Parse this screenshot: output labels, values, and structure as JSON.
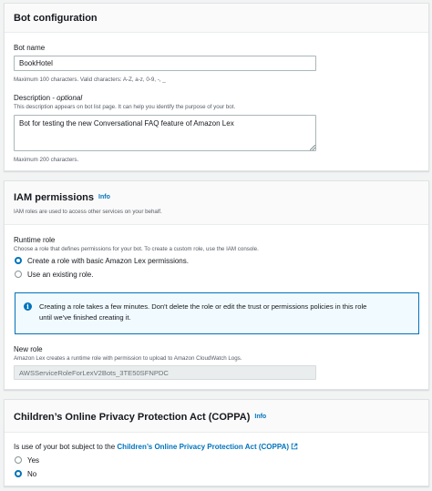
{
  "bot_configuration": {
    "title": "Bot configuration",
    "bot_name": {
      "label": "Bot name",
      "value": "BookHotel",
      "hint": "Maximum 100 characters. Valid characters: A-Z, a-z, 0-9, -, _"
    },
    "description": {
      "label": "Description",
      "optional": "optional",
      "separator": " - ",
      "help": "This description appears on bot list page. It can help you identify the purpose of your bot.",
      "value": "Bot for testing the new Conversational FAQ feature of Amazon Lex",
      "hint": "Maximum 200 characters."
    }
  },
  "iam_permissions": {
    "title": "IAM permissions",
    "info": "Info",
    "subtitle": "IAM roles are used to access other services on your behalf.",
    "runtime_role": {
      "label": "Runtime role",
      "help": "Choose a role that defines permissions for your bot. To create a custom role, use the IAM console.",
      "options": [
        {
          "label": "Create a role with basic Amazon Lex permissions.",
          "checked": true
        },
        {
          "label": "Use an existing role.",
          "checked": false
        }
      ]
    },
    "alert": {
      "icon": "info-circle-icon",
      "line1": "Creating a role takes a few minutes. Don't delete the role or edit the trust or permissions policies in this role",
      "line2": "until we've finished creating it."
    },
    "new_role": {
      "label": "New role",
      "help": "Amazon Lex creates a runtime role with permission to upload to Amazon CloudWatch Logs.",
      "value": "AWSServiceRoleForLexV2Bots_3TE50SFNPDC"
    }
  },
  "coppa": {
    "title": "Children’s Online Privacy Protection Act (COPPA)",
    "info": "Info",
    "question_prefix": "Is use of your bot subject to the ",
    "question_link": "Children’s Online Privacy Protection Act (COPPA)",
    "link_icon": "external-link-icon",
    "options": [
      {
        "label": "Yes",
        "checked": false
      },
      {
        "label": "No",
        "checked": true
      }
    ]
  },
  "colors": {
    "accent": "#0073bb",
    "text": "#16191f",
    "muted": "#545b64",
    "background": "#f2f3f3"
  }
}
